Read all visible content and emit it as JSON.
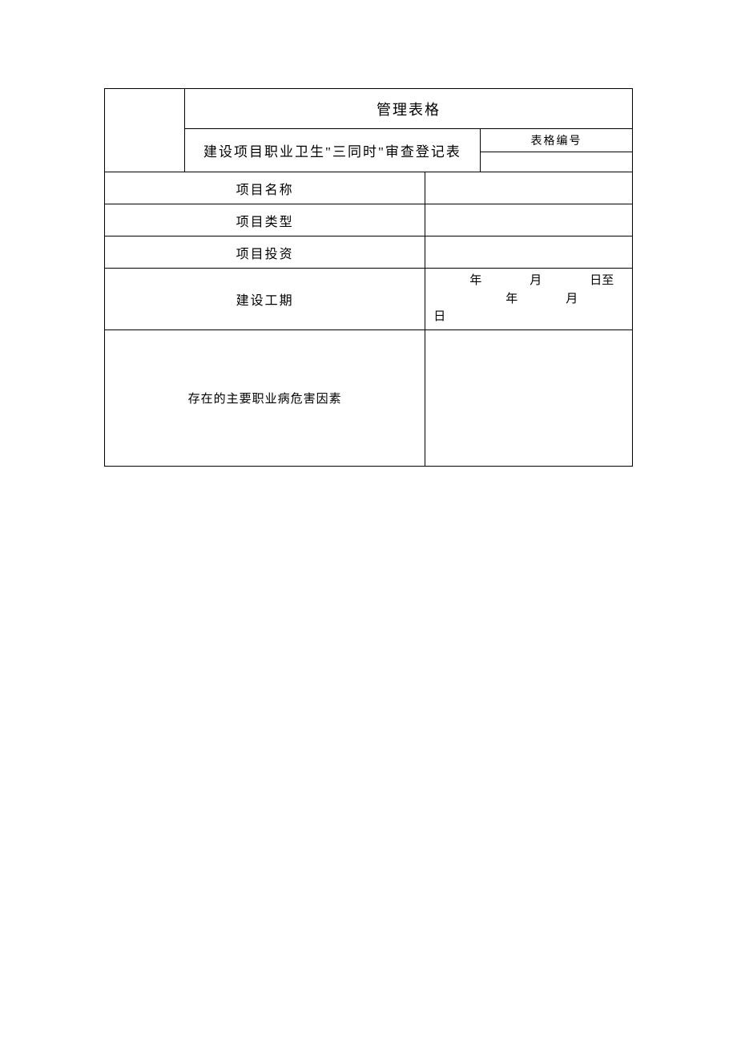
{
  "header": {
    "title": "管理表格",
    "subtitle": "建设项目职业卫生\"三同时\"审查登记表",
    "formNumberLabel": "表格编号",
    "formNumberValue": ""
  },
  "rows": {
    "projectName": {
      "label": "项目名称",
      "value": ""
    },
    "projectType": {
      "label": "项目类型",
      "value": ""
    },
    "projectInvestment": {
      "label": "项目投资",
      "value": ""
    },
    "constructionPeriod": {
      "label": "建设工期",
      "dateText": "　　　年　　　　月　　　　日至\n　　　　　　年　　　　月　　　　日"
    },
    "hazardFactors": {
      "label": "存在的主要职业病危害因素",
      "value": ""
    }
  }
}
